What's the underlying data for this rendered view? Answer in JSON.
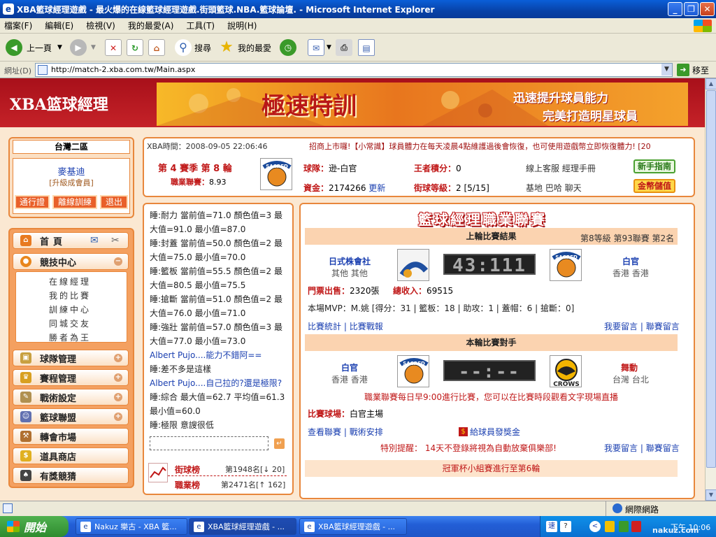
{
  "window": {
    "title": "XBA籃球經理遊戲 - 最火爆的在線籃球經理遊戲.街頭籃球.NBA.籃球論壇. - Microsoft Internet Explorer",
    "minimize": "_",
    "maximize": "❐",
    "close": "✕"
  },
  "menubar": [
    "檔案(F)",
    "編輯(E)",
    "檢視(V)",
    "我的最愛(A)",
    "工具(T)",
    "說明(H)"
  ],
  "toolbar": {
    "back": "上一頁",
    "search": "搜尋",
    "favorites": "我的最愛"
  },
  "address": {
    "label": "網址(D)",
    "url": "http://match-2.xba.com.tw/Main.aspx",
    "go": "移至"
  },
  "header": {
    "logo": "XBA篮球經理",
    "banner_title": "極速特訓",
    "banner_line1": "迅速提升球員能力",
    "banner_line2": "完美打造明星球員"
  },
  "userpanel": {
    "server": "台灣二區",
    "username": "麥基迪",
    "member": "[升級成會員]",
    "btn_pass": "通行證",
    "btn_train": "離線訓練",
    "btn_exit": "退出"
  },
  "sidenav": {
    "home": "首頁",
    "compete": "競技中心",
    "compete_items": [
      "在線經理",
      "我的比賽",
      "訓練中心",
      "同城交友",
      "勝者為王"
    ],
    "team": "球隊管理",
    "schedule": "賽程管理",
    "tactics": "戰術設定",
    "league": "籃球聯盟",
    "transfer": "轉會市場",
    "shop": "道具商店",
    "prize": "有獎競猜"
  },
  "info": {
    "time_label": "XBA時間：",
    "time": "2008-09-05 22:06:46",
    "ticker": "招商上市囉!【小常識】球員體力在每天凌晨4點維護過後會恢復，也可使用遊戲幣立即恢復體力! [20",
    "season": "第 4 賽季 第 8 輪",
    "league_label": "職業聯賽：",
    "league_val": "8.93",
    "team_label": "球隊：",
    "team": "逊-白官",
    "funds_label": "資金：",
    "funds": "2174266",
    "update": "更新",
    "king_label": "王者積分：",
    "king": "0",
    "level_label": "街球等級：",
    "level": "2 [5/15]",
    "links1": "線上客服  經理手冊",
    "links2": "基地  巴哈  聊天",
    "guide_btn": "新手指南",
    "gold_btn": "金幣儲值"
  },
  "messages": [
    {
      "text": "睡:耐力 當前值=71.0 顏色值=3 最大值=91.0 最小值=87.0",
      "color": "#222222",
      "tall": 2
    },
    {
      "text": "睡:封蓋 當前值=50.0 顏色值=2 最大值=75.0 最小值=70.0",
      "color": "#222222",
      "tall": 2
    },
    {
      "text": "睡:籃板 當前值=55.5 顏色值=2 最大值=80.5 最小值=75.5",
      "color": "#222222",
      "tall": 2
    },
    {
      "text": "睡:搶斷 當前值=51.0 顏色值=2 最大值=76.0 最小值=71.0",
      "color": "#222222",
      "tall": 2
    },
    {
      "text": "睡:強壯 當前值=57.0 顏色值=3 最大值=77.0 最小值=73.0",
      "color": "#222222",
      "tall": 2
    },
    {
      "text": "Albert Pujo....能力不錯阿==",
      "color": "#1a3fb0",
      "tall": 1
    },
    {
      "text": "睡:差不多是這樣",
      "color": "#222222",
      "tall": 1
    },
    {
      "text": "Albert Pujo....自己拉的?還是極限?",
      "color": "#1a3fb0",
      "tall": 1
    },
    {
      "text": "睡:綜合 最大值=62.7 平均值=61.3 最小值=60.0",
      "color": "#222222",
      "tall": 2
    },
    {
      "text": "睡:極限 意謏很低",
      "color": "#222222",
      "tall": 1
    }
  ],
  "rank": {
    "street_label": "街球榜",
    "street_val": "第1948名[↓ 20]",
    "pro_label": "職業榜",
    "pro_val": "第2471名[↑ 162]"
  },
  "league": {
    "title": "籃球經理職業聯賽",
    "last_header": "上輪比賽結果",
    "last_meta": "第8等級 第93聯賽 第2名",
    "home_team": "日式株會社",
    "home_loc": "其他 其他",
    "score": "43:111",
    "away_team": "白官",
    "away_loc": "香港 香港",
    "tickets_label": "門票出售：",
    "tickets": "2320張",
    "income_label": "總收入：",
    "income": "69515",
    "mvp": "本場MVP：M.姚 [得分：31 | 籃板：18 | 助攻：1 | 蓋帽：6 | 搶斷：0]",
    "stats_link": "比賽統計",
    "report_link": "比賽戰報",
    "comment_link": "我要留言",
    "league_comment": "聯賽留言",
    "next_header": "本輪比賽對手",
    "next_home": "白官",
    "next_home_loc": "香港 香港",
    "next_score": "--:--",
    "next_away": "舞動",
    "next_away_loc": "台灣 台北",
    "note": "職業聯賽每日早9:00進行比賽，您可以在比賽時段觀看文字現場直播",
    "venue_label": "比賽球場：",
    "venue": "白官主場",
    "view_link": "查看聯賽",
    "tactic_link": "戰術安排",
    "bonus_link": "給球員發獎金",
    "reminder": "特別提醒：  14天不登錄將視為自動放棄俱樂部!",
    "cup": "冠軍杯小組賽進行至第6輪",
    "logo_sacred": "SACRED",
    "logo_crows": "CROWS"
  },
  "status": {
    "zone": "網際網路"
  },
  "taskbar": {
    "start": "開始",
    "tasks": [
      "Nakuz 樂古 - XBA 籃...",
      "XBA籃球經理遊戲 - ...",
      "XBA籃球經理遊戲 - ..."
    ],
    "clock": "下午 10:06",
    "watermark": "nakuz.com"
  }
}
